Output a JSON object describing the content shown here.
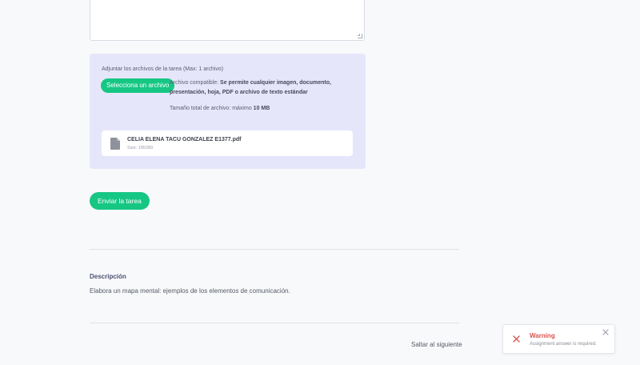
{
  "upload": {
    "title": "Adjuntar los archivos de la tarea (Max: 1 archivo)",
    "select_label": "Selecciona un archivo",
    "compat_prefix": "Archivo compatible:",
    "compat_bold": "Se permite cualquier imagen, documento, presentación, hoja, PDF o archivo de texto estándar",
    "size_prefix": "Tamaño total de archivo: máximo",
    "size_bold": "10 MB",
    "file": {
      "name": "CELIA ELENA TACU GONZALEZ E1377.pdf",
      "size": "Size: 185389"
    }
  },
  "submit_label": "Enviar la tarea",
  "description": {
    "title": "Descripción",
    "text": "Elabora un mapa mental: ejemplos de los elementos de comunicación."
  },
  "next_label": "Saltar al siguiente",
  "toast": {
    "title": "Warning",
    "message": "Assignment answer is required.",
    "icon": "close-x-icon"
  },
  "colors": {
    "accent": "#16c784",
    "panel": "#e6e6fb",
    "warning": "#d9534f"
  }
}
